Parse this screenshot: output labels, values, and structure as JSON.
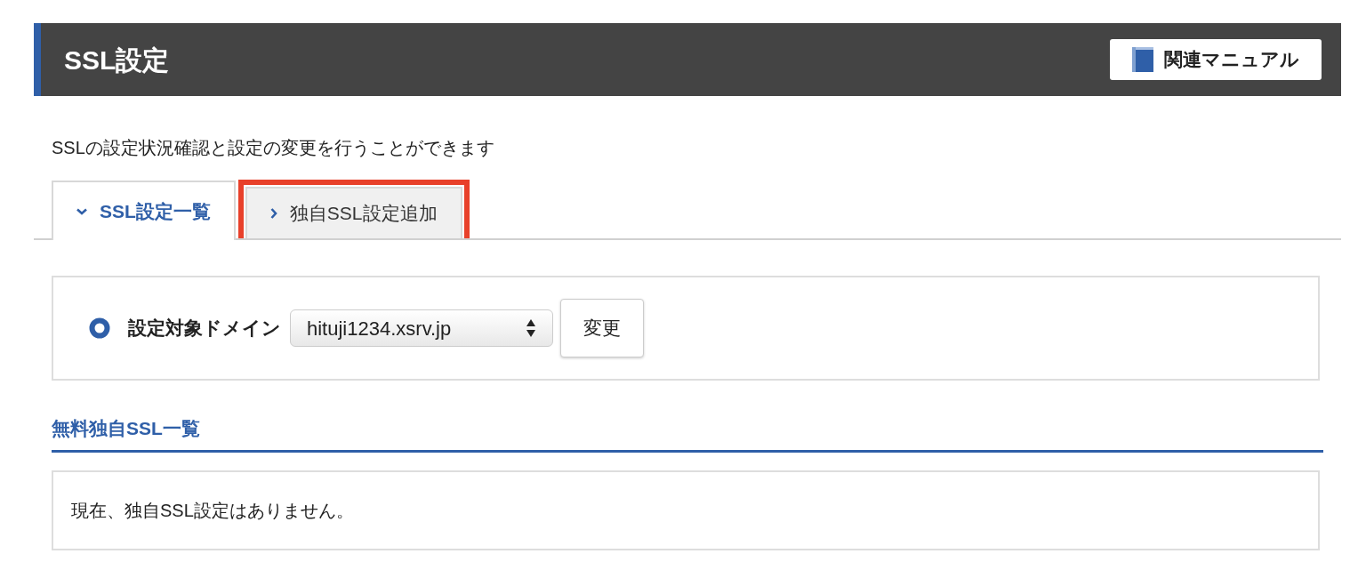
{
  "header": {
    "title": "SSL設定",
    "manual_button": "関連マニュアル"
  },
  "description": "SSLの設定状況確認と設定の変更を行うことができます",
  "tabs": [
    {
      "label": "SSL設定一覧",
      "selected": true,
      "highlighted": false
    },
    {
      "label": "独自SSL設定追加",
      "selected": false,
      "highlighted": true
    }
  ],
  "domain_panel": {
    "label": "設定対象ドメイン",
    "select_value": "hituji1234.xsrv.jp",
    "button": "変更"
  },
  "section": {
    "title": "無料独自SSL一覧",
    "message": "現在、独自SSL設定はありません。"
  }
}
